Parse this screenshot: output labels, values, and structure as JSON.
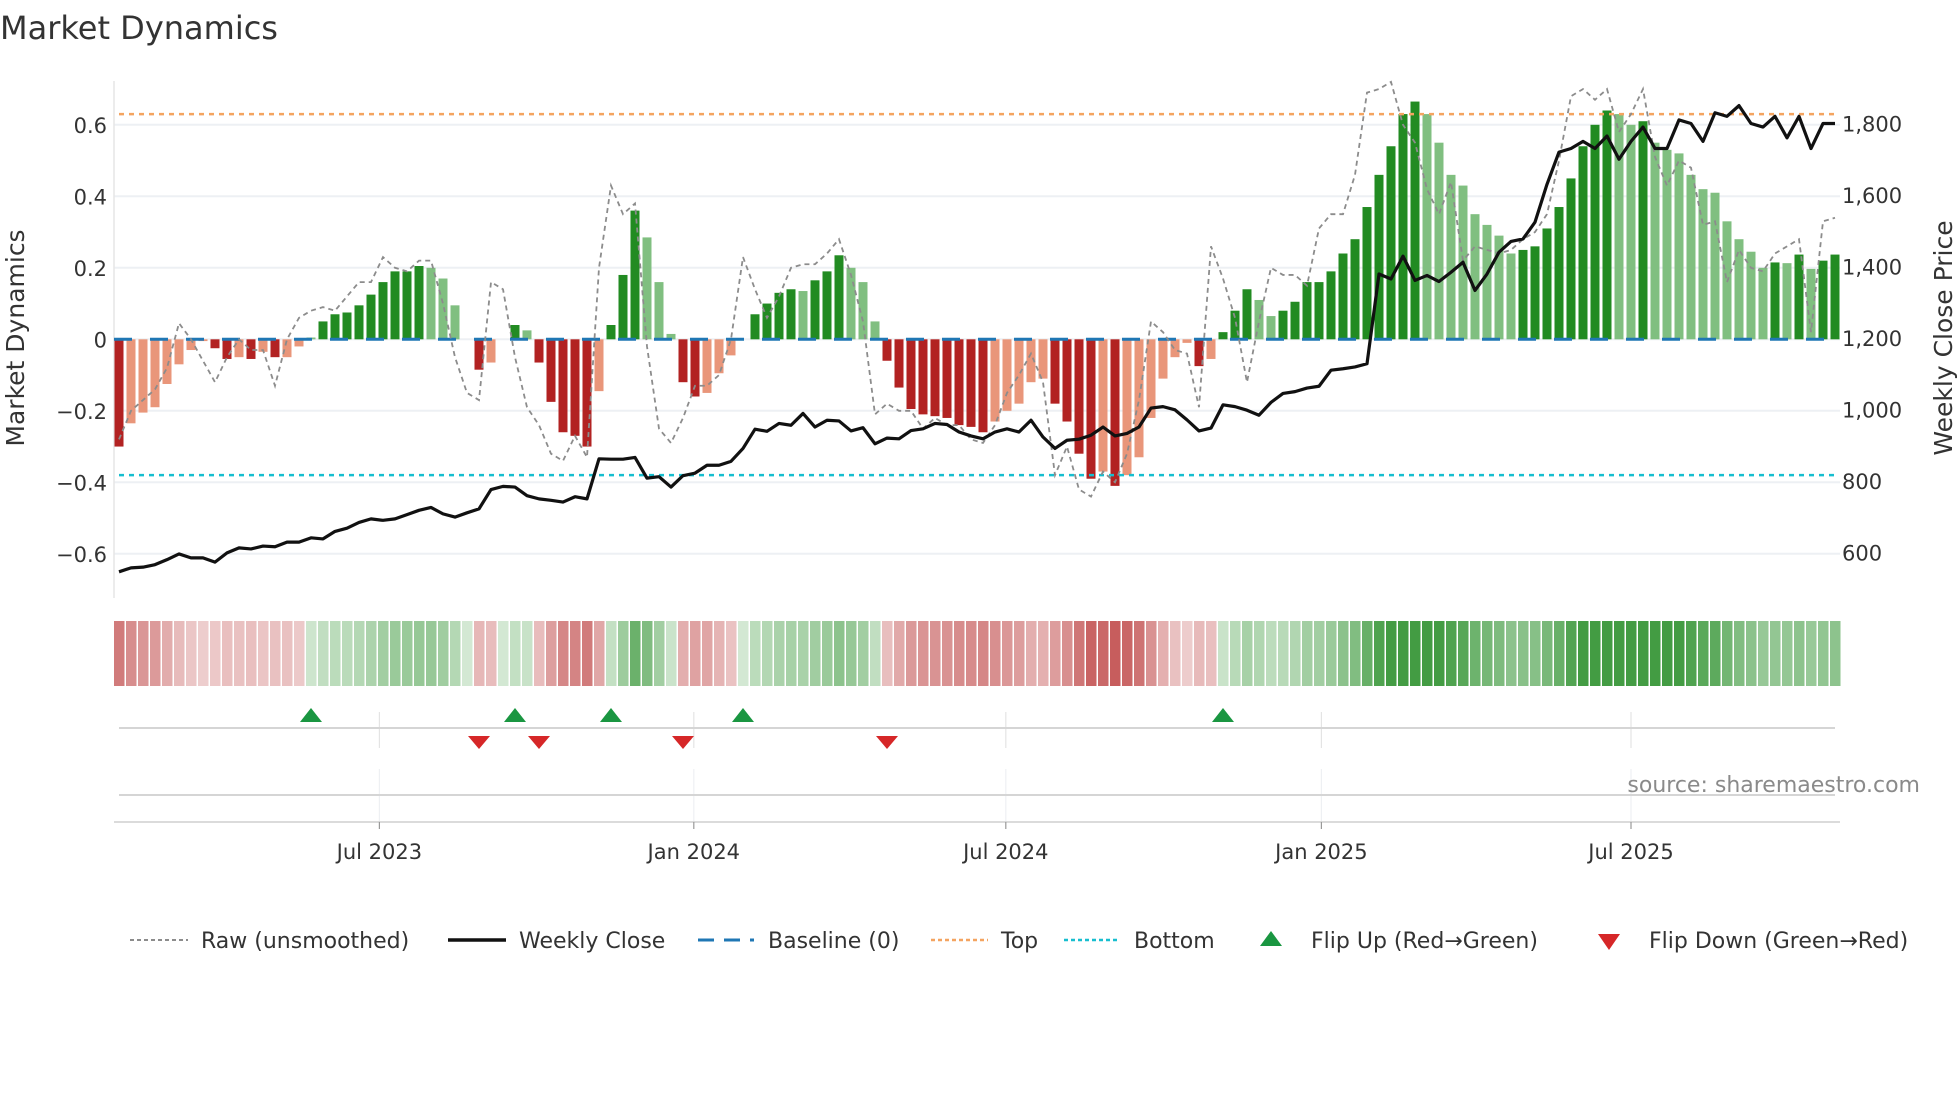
{
  "title": "Market Dynamics",
  "source": "source: sharemaestro.com",
  "colors": {
    "neg_strong": "#b22222",
    "neg_weak": "#e9967a",
    "pos_strong": "#228b22",
    "pos_weak": "#80bf80",
    "raw": "#8c8c8c",
    "close": "#111111",
    "baseline": "#1f77b4",
    "top": "#f4a460",
    "bottom": "#17becf",
    "flip_up": "#1a9641",
    "flip_down": "#d62728"
  },
  "legend": {
    "raw": "Raw (unsmoothed)",
    "close": "Weekly Close",
    "baseline": "Baseline (0)",
    "top": "Top",
    "bottom": "Bottom",
    "flip_up": "Flip Up (Red→Green)",
    "flip_down": "Flip Down (Green→Red)"
  },
  "chart_data": {
    "type": "bar",
    "title": "Market Dynamics",
    "ylabel": "Market Dynamics",
    "y2label": "Weekly Close Price",
    "ylim": [
      -0.72,
      0.72
    ],
    "y2lim": [
      500,
      1920
    ],
    "yticks": [
      -0.6,
      -0.4,
      -0.2,
      0,
      0.2,
      0.4,
      0.6
    ],
    "yticklabels": [
      "−0.6",
      "−0.4",
      "−0.2",
      "0",
      "0.2",
      "0.4",
      "0.6"
    ],
    "y2ticks": [
      600,
      800,
      1000,
      1200,
      1400,
      1600,
      1800
    ],
    "y2ticklabels": [
      "600",
      "800",
      "1,000",
      "1,200",
      "1,400",
      "1,600",
      "1,800"
    ],
    "xticks": [
      {
        "label": "Jul 2023",
        "week": 21.7
      },
      {
        "label": "Jan 2024",
        "week": 47.9
      },
      {
        "label": "Jul 2024",
        "week": 73.9
      },
      {
        "label": "Jan 2025",
        "week": 100.2
      },
      {
        "label": "Jul 2025",
        "week": 126
      }
    ],
    "top_level": 0.63,
    "bottom_level": -0.38,
    "baseline": 0,
    "smoothed": [
      -0.3,
      -0.235,
      -0.205,
      -0.19,
      -0.125,
      -0.07,
      -0.03,
      -0.005,
      -0.025,
      -0.055,
      -0.05,
      -0.055,
      -0.035,
      -0.05,
      -0.05,
      -0.02,
      0.005,
      0.05,
      0.07,
      0.075,
      0.095,
      0.125,
      0.16,
      0.19,
      0.19,
      0.205,
      0.2,
      0.17,
      0.095,
      0,
      -0.085,
      -0.065,
      0,
      0.04,
      0.025,
      -0.065,
      -0.175,
      -0.26,
      -0.27,
      -0.3,
      -0.145,
      0.04,
      0.18,
      0.36,
      0.285,
      0.16,
      0.015,
      -0.12,
      -0.16,
      -0.15,
      -0.095,
      -0.045,
      0,
      0.07,
      0.1,
      0.13,
      0.14,
      0.135,
      0.165,
      0.19,
      0.235,
      0.2,
      0.16,
      0.05,
      -0.06,
      -0.135,
      -0.195,
      -0.21,
      -0.215,
      -0.22,
      -0.24,
      -0.245,
      -0.26,
      -0.23,
      -0.2,
      -0.18,
      -0.12,
      -0.11,
      -0.18,
      -0.23,
      -0.32,
      -0.39,
      -0.37,
      -0.41,
      -0.38,
      -0.33,
      -0.22,
      -0.11,
      -0.05,
      -0.01,
      -0.075,
      -0.055,
      0.02,
      0.08,
      0.14,
      0.11,
      0.065,
      0.08,
      0.105,
      0.16,
      0.16,
      0.19,
      0.24,
      0.28,
      0.37,
      0.46,
      0.54,
      0.63,
      0.665,
      0.63,
      0.55,
      0.46,
      0.43,
      0.35,
      0.32,
      0.29,
      0.24,
      0.25,
      0.26,
      0.31,
      0.37,
      0.45,
      0.54,
      0.6,
      0.64,
      0.63,
      0.6,
      0.61,
      0.55,
      0.53,
      0.52,
      0.46,
      0.42,
      0.41,
      0.33,
      0.28,
      0.245,
      0.2,
      0.215,
      0.213,
      0.237,
      0.197,
      0.22,
      0.237
    ],
    "strong": [
      1,
      0,
      0,
      0,
      0,
      0,
      0,
      0,
      1,
      1,
      0,
      1,
      0,
      1,
      0,
      0,
      0,
      1,
      1,
      1,
      1,
      1,
      1,
      1,
      1,
      1,
      0,
      0,
      0,
      0,
      1,
      0,
      0,
      1,
      0,
      1,
      1,
      1,
      1,
      1,
      0,
      1,
      1,
      1,
      0,
      0,
      0,
      1,
      1,
      0,
      0,
      0,
      0,
      1,
      1,
      1,
      1,
      0,
      1,
      1,
      1,
      0,
      0,
      0,
      1,
      1,
      1,
      1,
      1,
      1,
      1,
      1,
      1,
      0,
      0,
      0,
      0,
      0,
      1,
      1,
      1,
      1,
      0,
      1,
      0,
      0,
      0,
      0,
      0,
      0,
      1,
      0,
      1,
      1,
      1,
      0,
      0,
      1,
      1,
      1,
      1,
      1,
      1,
      1,
      1,
      1,
      1,
      1,
      1,
      0,
      0,
      0,
      0,
      0,
      0,
      0,
      0,
      1,
      1,
      1,
      1,
      1,
      1,
      1,
      1,
      0,
      0,
      1,
      0,
      0,
      0,
      0,
      0,
      0,
      0,
      0,
      0,
      0,
      1,
      0,
      1,
      0,
      1,
      1
    ],
    "raw": [
      -0.28,
      -0.2,
      -0.17,
      -0.14,
      -0.08,
      0.045,
      0.0,
      -0.06,
      -0.12,
      -0.05,
      0.0,
      -0.03,
      -0.03,
      -0.13,
      0.0,
      0.06,
      0.08,
      0.09,
      0.08,
      0.12,
      0.16,
      0.16,
      0.23,
      0.2,
      0.19,
      0.22,
      0.22,
      0.1,
      -0.05,
      -0.15,
      -0.17,
      0.16,
      0.14,
      -0.05,
      -0.19,
      -0.24,
      -0.32,
      -0.34,
      -0.27,
      -0.33,
      0.2,
      0.43,
      0.35,
      0.38,
      -0.02,
      -0.25,
      -0.29,
      -0.22,
      -0.13,
      -0.13,
      -0.1,
      0.0,
      0.23,
      0.14,
      0.06,
      0.12,
      0.2,
      0.21,
      0.21,
      0.24,
      0.28,
      0.18,
      0.05,
      -0.21,
      -0.18,
      -0.2,
      -0.2,
      -0.25,
      -0.22,
      -0.24,
      -0.24,
      -0.28,
      -0.29,
      -0.24,
      -0.15,
      -0.1,
      -0.04,
      -0.12,
      -0.38,
      -0.3,
      -0.42,
      -0.44,
      -0.37,
      -0.4,
      -0.32,
      -0.17,
      0.05,
      0.02,
      -0.03,
      -0.04,
      -0.19,
      0.26,
      0.17,
      0.06,
      -0.12,
      0.05,
      0.2,
      0.18,
      0.18,
      0.15,
      0.31,
      0.35,
      0.35,
      0.46,
      0.69,
      0.7,
      0.72,
      0.6,
      0.55,
      0.42,
      0.35,
      0.44,
      0.22,
      0.26,
      0.25,
      0.24,
      0.25,
      0.28,
      0.3,
      0.35,
      0.5,
      0.68,
      0.7,
      0.67,
      0.7,
      0.58,
      0.63,
      0.7,
      0.51,
      0.43,
      0.5,
      0.48,
      0.32,
      0.33,
      0.16,
      0.25,
      0.2,
      0.19,
      0.24,
      0.26,
      0.28,
      0.02,
      0.33,
      0.34
    ],
    "close": [
      546,
      557,
      559,
      566,
      580,
      596,
      585,
      585,
      573,
      599,
      613,
      610,
      618,
      616,
      629,
      629,
      641,
      638,
      659,
      668,
      684,
      694,
      690,
      694,
      706,
      718,
      726,
      708,
      699,
      711,
      722,
      776,
      785,
      783,
      759,
      750,
      746,
      741,
      756,
      750,
      862,
      861,
      861,
      866,
      808,
      812,
      783,
      815,
      822,
      844,
      844,
      855,
      891,
      945,
      939,
      961,
      956,
      989,
      951,
      970,
      968,
      940,
      949,
      904,
      920,
      918,
      941,
      946,
      961,
      958,
      937,
      926,
      918,
      937,
      946,
      937,
      970,
      923,
      891,
      914,
      917,
      928,
      951,
      926,
      933,
      951,
      1004,
      1008,
      999,
      971,
      940,
      948,
      1013,
      1008,
      998,
      984,
      1020,
      1045,
      1050,
      1060,
      1065,
      1110,
      1114,
      1119,
      1128,
      1379,
      1365,
      1429,
      1361,
      1375,
      1358,
      1384,
      1412,
      1333,
      1379,
      1440,
      1470,
      1477,
      1524,
      1630,
      1720,
      1730,
      1750,
      1730,
      1765,
      1700,
      1750,
      1790,
      1730,
      1730,
      1810,
      1800,
      1750,
      1830,
      1820,
      1850,
      1800,
      1790,
      1820,
      1760,
      1820,
      1730,
      1800,
      1800
    ],
    "flip_up_weeks": [
      16,
      33,
      41,
      52,
      92
    ],
    "flip_down_weeks": [
      30,
      35,
      47,
      64
    ]
  }
}
